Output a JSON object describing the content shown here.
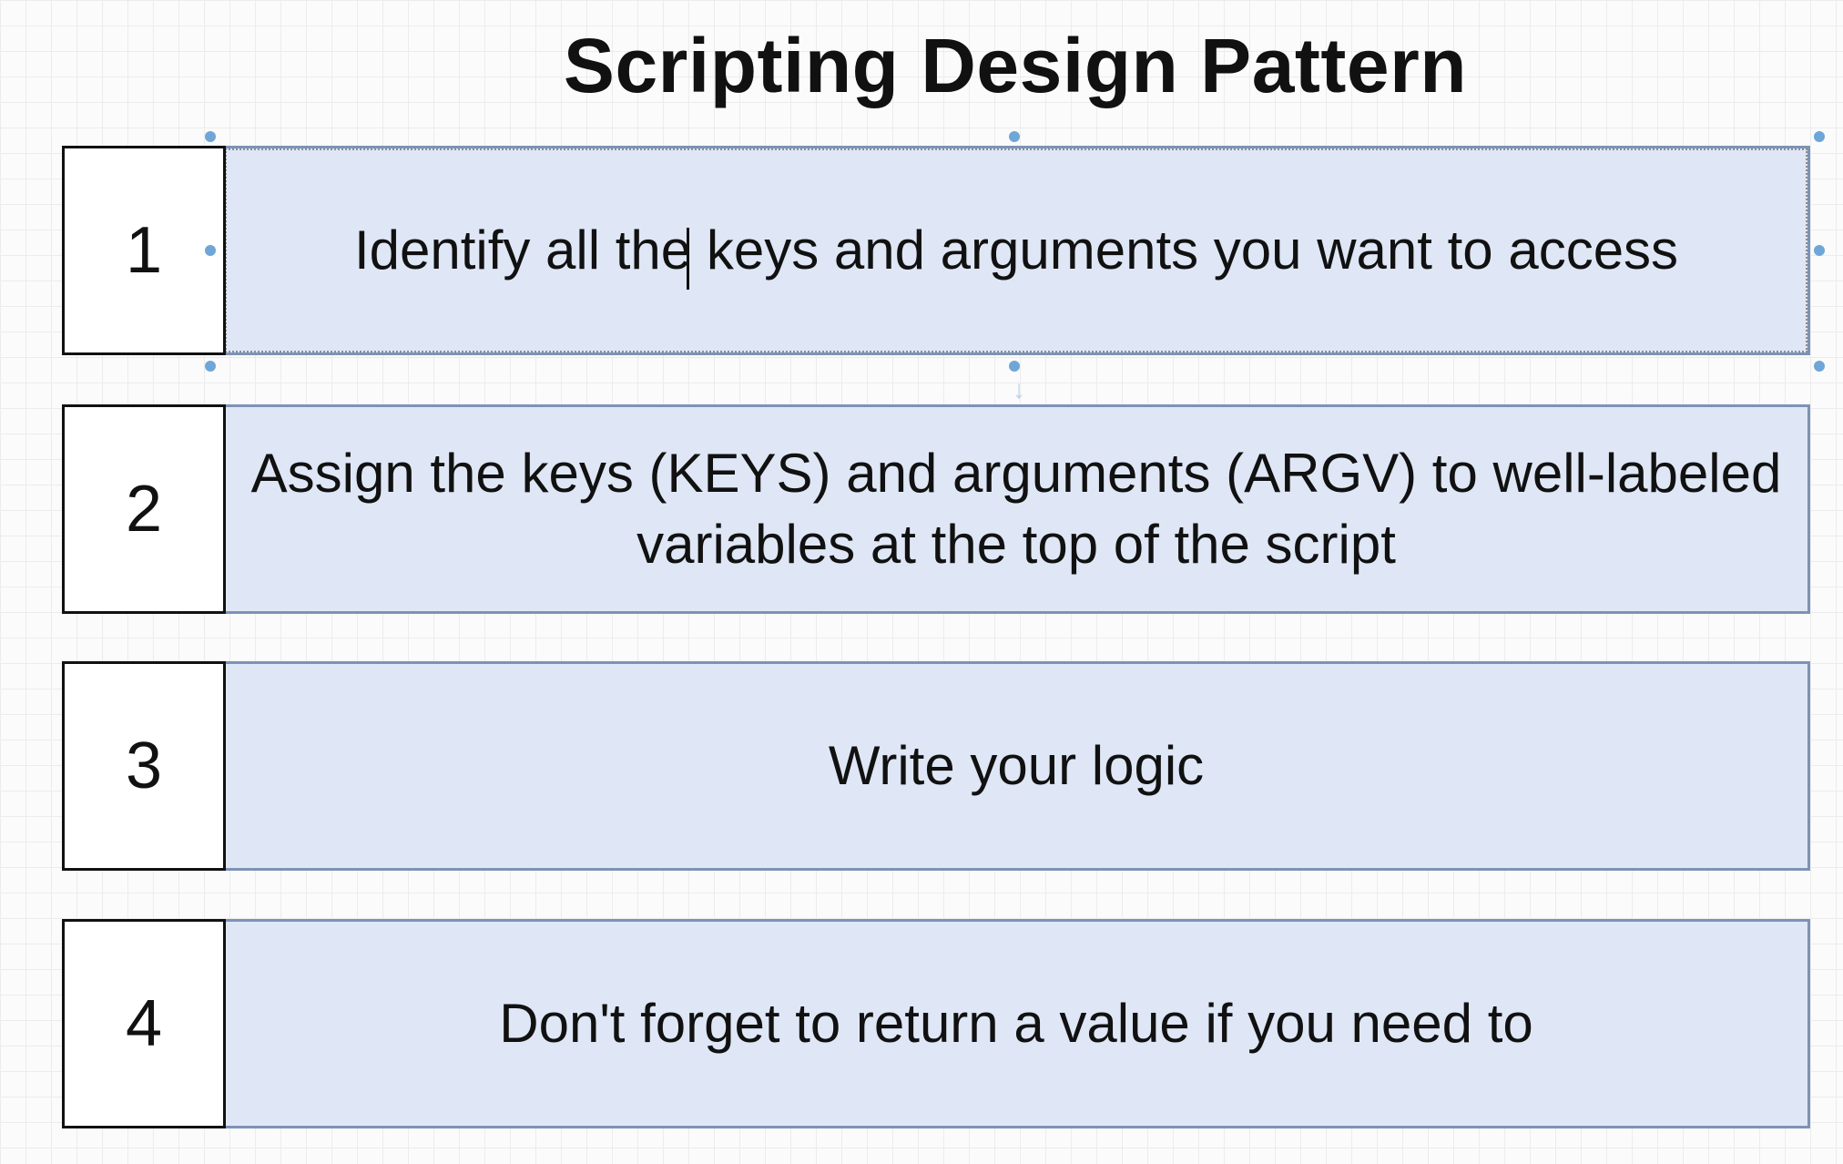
{
  "title": "Scripting Design Pattern",
  "steps": [
    {
      "number": "1",
      "text": "Identify all the keys and arguments you want to access"
    },
    {
      "number": "2",
      "text": "Assign the keys (KEYS) and arguments (ARGV) to well-labeled variables at the top of the script"
    },
    {
      "number": "3",
      "text": "Write your logic"
    },
    {
      "number": "4",
      "text": "Don't forget to return a value if you need to"
    }
  ],
  "colors": {
    "box_fill": "#dfe7f6",
    "box_border": "#7d93b6",
    "number_border": "#111111",
    "selection_handle": "#6fa6d8"
  },
  "icons": {
    "text_cursor": "text-cursor-icon",
    "connector_arrow": "arrow-down-icon"
  }
}
